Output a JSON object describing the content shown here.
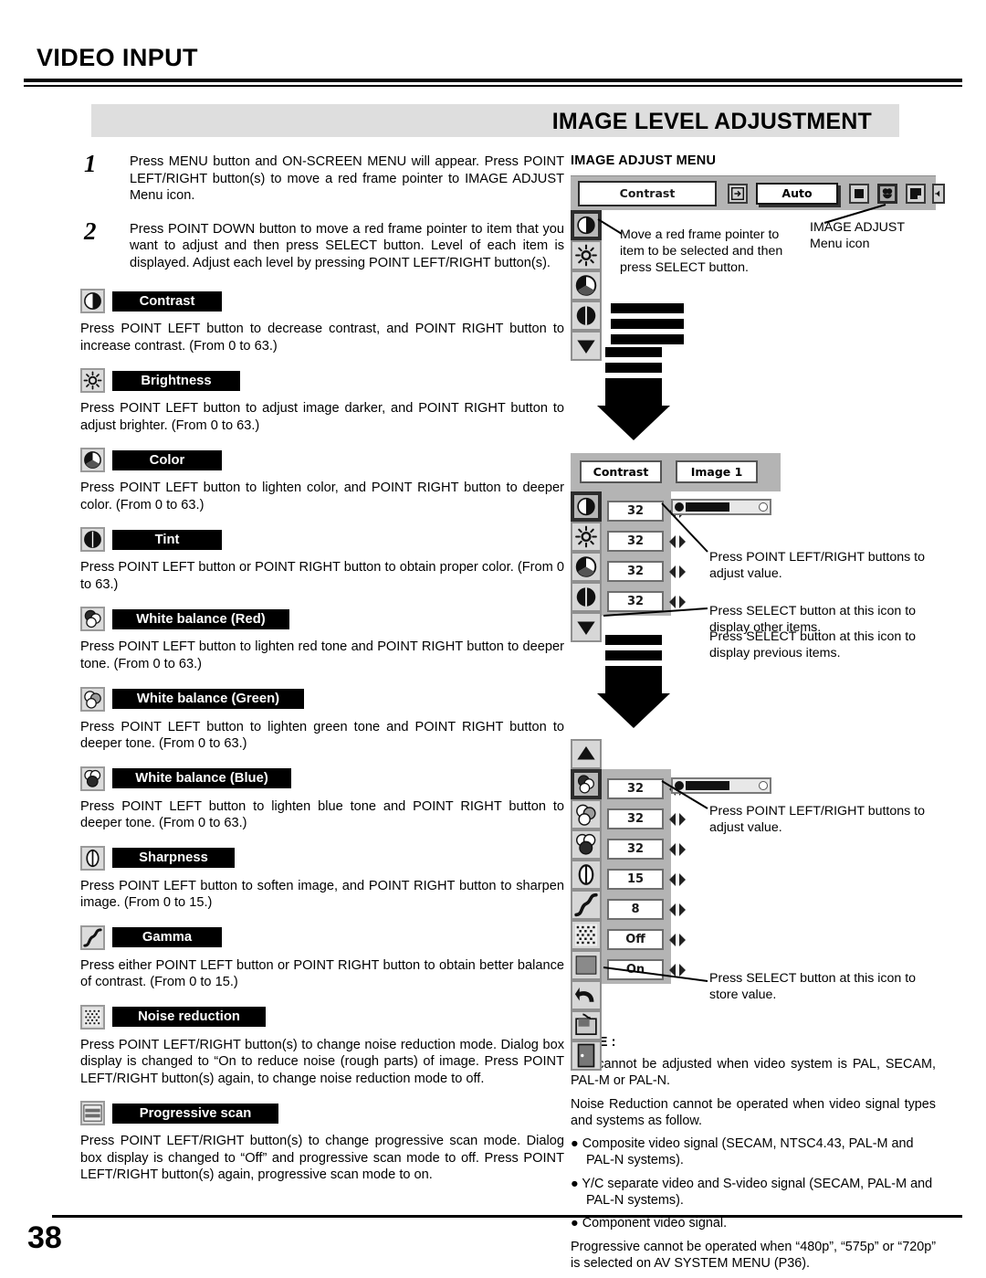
{
  "header": {
    "section_title": "VIDEO INPUT",
    "banner_title": "IMAGE LEVEL ADJUSTMENT"
  },
  "steps": [
    {
      "number": "1",
      "text": "Press MENU button and ON-SCREEN MENU will appear.  Press POINT LEFT/RIGHT button(s) to move a red frame pointer to IMAGE ADJUST Menu icon."
    },
    {
      "number": "2",
      "text": "Press POINT DOWN button to move a red frame pointer to item that you want to adjust and then press SELECT button.  Level of each item is displayed.  Adjust each level by pressing POINT LEFT/RIGHT button(s)."
    }
  ],
  "items": [
    {
      "icon": "contrast-icon",
      "label": "Contrast",
      "body": "Press POINT LEFT button to decrease contrast, and POINT RIGHT button to increase contrast.  (From 0 to 63.)"
    },
    {
      "icon": "brightness-icon",
      "label": "Brightness",
      "body": "Press POINT LEFT button to adjust image darker, and POINT RIGHT button to adjust brighter.  (From 0 to 63.)"
    },
    {
      "icon": "color-icon",
      "label": "Color",
      "body": "Press POINT LEFT button to lighten color, and POINT RIGHT button to deeper color.  (From 0 to 63.)"
    },
    {
      "icon": "tint-icon",
      "label": "Tint",
      "body": "Press POINT LEFT button or POINT RIGHT button to obtain proper color.  (From 0 to 63.)"
    },
    {
      "icon": "white-balance-red-icon",
      "label": "White balance (Red)",
      "body": "Press POINT LEFT button to lighten red tone and POINT RIGHT button to deeper tone.  (From 0 to 63.)"
    },
    {
      "icon": "white-balance-green-icon",
      "label": "White balance (Green)",
      "body": "Press POINT LEFT button to lighten green tone and POINT RIGHT button to deeper tone.  (From 0 to 63.)"
    },
    {
      "icon": "white-balance-blue-icon",
      "label": "White balance (Blue)",
      "body": "Press POINT LEFT button to lighten blue tone and POINT RIGHT button to deeper tone.  (From 0 to 63.)"
    },
    {
      "icon": "sharpness-icon",
      "label": "Sharpness",
      "body": "Press POINT LEFT button to soften image, and POINT RIGHT button to sharpen image.  (From 0 to 15.)"
    },
    {
      "icon": "gamma-icon",
      "label": "Gamma",
      "body": "Press either POINT LEFT button or POINT RIGHT button to obtain better balance of contrast.  (From 0 to 15.)"
    },
    {
      "icon": "noise-reduction-icon",
      "label": "Noise reduction",
      "body": "Press POINT LEFT/RIGHT button(s) to change noise reduction mode. Dialog box display is changed to “On to reduce noise (rough parts) of image. Press POINT LEFT/RIGHT button(s) again, to change noise reduction mode to off."
    },
    {
      "icon": "progressive-scan-icon",
      "label": "Progressive scan",
      "body": "Press POINT LEFT/RIGHT button(s) to change progressive scan mode.  Dialog box display is changed to “Off” and progressive scan mode to off. Press POINT LEFT/RIGHT button(s) again, progressive scan mode to on."
    }
  ],
  "right": {
    "menu_caption": "IMAGE ADJUST MENU",
    "menu_bar": {
      "current_item": "Contrast",
      "auto_label": "Auto"
    },
    "callout_select_item": "Move a red frame pointer to item to be selected and then press SELECT button.",
    "callout_menu_icon": "IMAGE ADJUST\nMenu icon",
    "callout_menu_icon_line1": "IMAGE ADJUST",
    "callout_menu_icon_line2": "Menu icon",
    "panel2": {
      "tab_left": "Contrast",
      "tab_right": "Image 1",
      "values": [
        "32",
        "32",
        "32",
        "32"
      ],
      "icons": [
        "contrast-icon",
        "brightness-icon",
        "color-icon",
        "tint-icon"
      ]
    },
    "panel3": {
      "values": [
        "32",
        "32",
        "32",
        "15",
        "8",
        "Off",
        "On"
      ],
      "icons": [
        "white-balance-red-icon",
        "white-balance-green-icon",
        "white-balance-blue-icon",
        "sharpness-icon",
        "gamma-icon",
        "noise-reduction-icon",
        "progressive-scan-icon"
      ]
    },
    "callout_adjust_value_1": "Press POINT LEFT/RIGHT buttons to adjust value.",
    "callout_display_other": "Press SELECT button at this icon to display other items.",
    "callout_display_previous": "Press SELECT button at this icon to display previous items.",
    "callout_adjust_value_2": "Press POINT LEFT/RIGHT buttons to adjust value.",
    "callout_store_value": "Press SELECT button at this icon to store value."
  },
  "note": {
    "title": "NOTE :",
    "p1": "Tint cannot be adjusted when video system is PAL, SECAM, PAL-M or PAL-N.",
    "p2": "Noise Reduction cannot be operated when video signal types and systems as follow.",
    "b1": "● Composite video signal (SECAM, NTSC4.43, PAL-M and PAL-N systems).",
    "b2": "● Y/C separate video and S-video signal (SECAM, PAL-M and PAL-N systems).",
    "b3": "● Component video signal.",
    "p3": "Progressive cannot be operated when “480p”, “575p” or “720p” is selected on AV SYSTEM MENU (P36)."
  },
  "footer": {
    "page_number": "38"
  },
  "colors": {
    "banner_bg": "#dedede",
    "panel_gray": "#b4b4b4",
    "icon_box_bg": "#dcdcdc",
    "label_bg": "#000000"
  }
}
